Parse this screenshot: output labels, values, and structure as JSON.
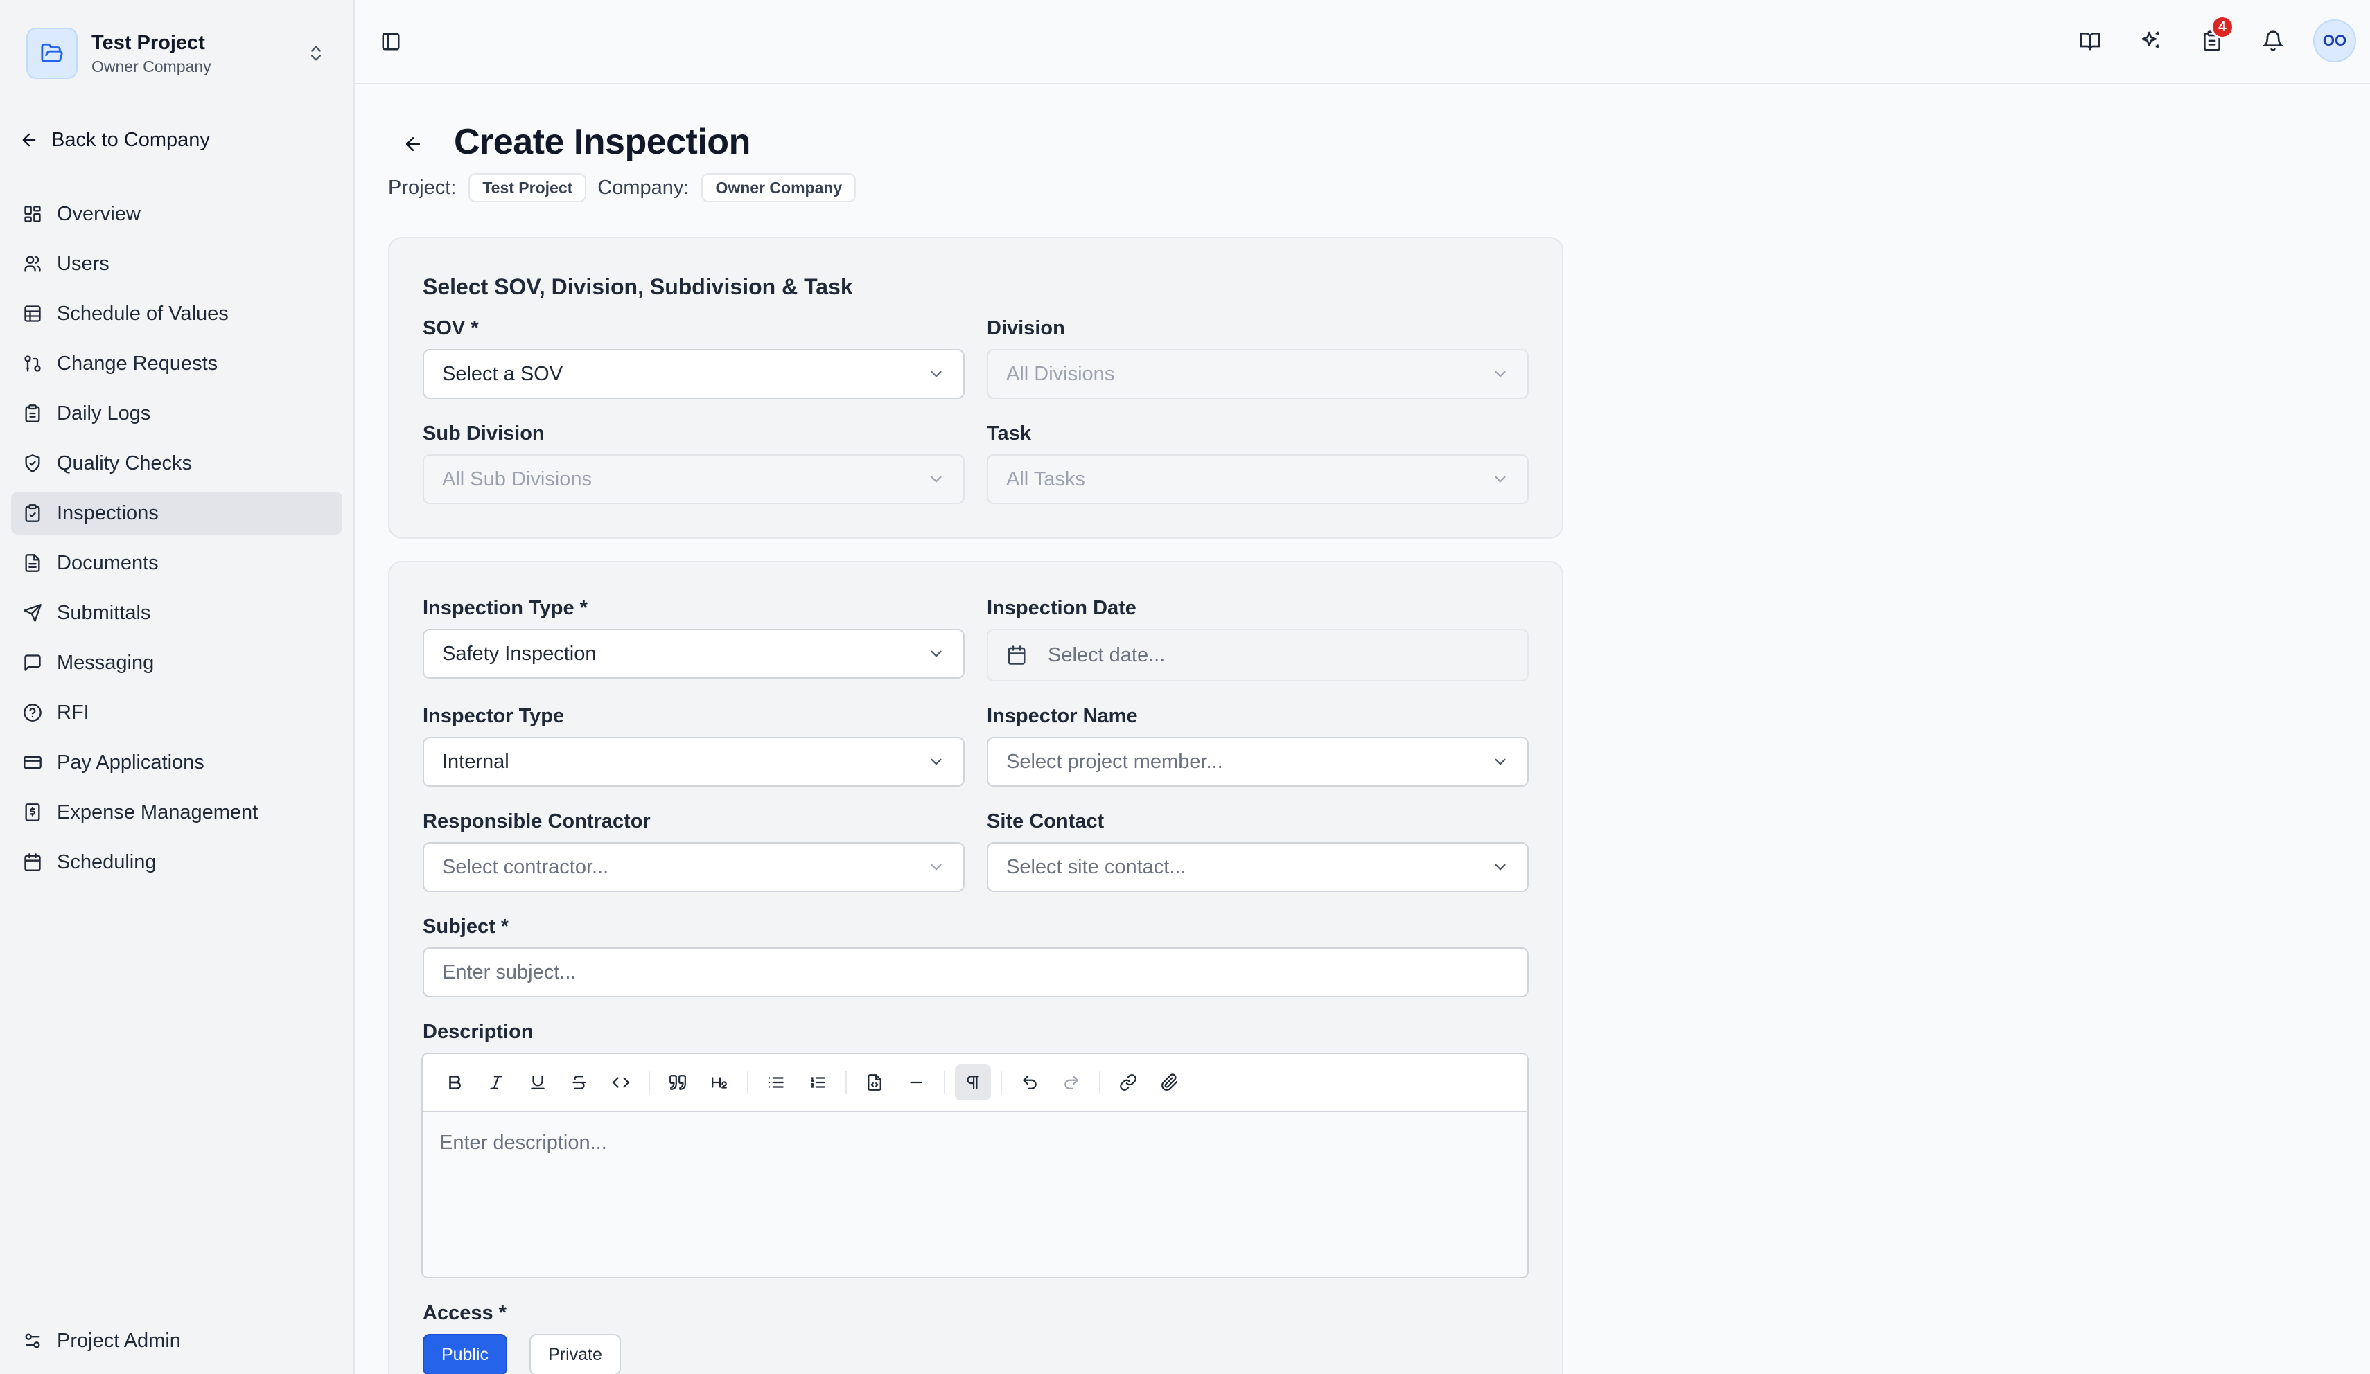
{
  "sidebar": {
    "project_name": "Test Project",
    "company_name": "Owner Company",
    "back_label": "Back to Company",
    "items": [
      {
        "label": "Overview",
        "icon": "layout-dashboard-icon"
      },
      {
        "label": "Users",
        "icon": "users-icon"
      },
      {
        "label": "Schedule of Values",
        "icon": "table-icon"
      },
      {
        "label": "Change Requests",
        "icon": "git-pull-request-icon"
      },
      {
        "label": "Daily Logs",
        "icon": "clipboard-icon"
      },
      {
        "label": "Quality Checks",
        "icon": "shield-check-icon"
      },
      {
        "label": "Inspections",
        "icon": "clipboard-check-icon",
        "active": true
      },
      {
        "label": "Documents",
        "icon": "file-text-icon"
      },
      {
        "label": "Submittals",
        "icon": "send-icon"
      },
      {
        "label": "Messaging",
        "icon": "message-square-icon"
      },
      {
        "label": "RFI",
        "icon": "help-circle-icon"
      },
      {
        "label": "Pay Applications",
        "icon": "credit-card-icon"
      },
      {
        "label": "Expense Management",
        "icon": "receipt-icon"
      },
      {
        "label": "Scheduling",
        "icon": "calendar-icon"
      }
    ],
    "admin_label": "Project Admin"
  },
  "topbar": {
    "tasks_badge": "4",
    "avatar_initials": "OO"
  },
  "page": {
    "title": "Create Inspection",
    "project_label": "Project:",
    "project_value": "Test Project",
    "company_label": "Company:",
    "company_value": "Owner Company"
  },
  "section1": {
    "title": "Select SOV, Division, Subdivision & Task",
    "sov_label": "SOV *",
    "sov_value": "Select a SOV",
    "division_label": "Division",
    "division_value": "All Divisions",
    "subdivision_label": "Sub Division",
    "subdivision_value": "All Sub Divisions",
    "task_label": "Task",
    "task_value": "All Tasks"
  },
  "section2": {
    "inspection_type_label": "Inspection Type *",
    "inspection_type_value": "Safety Inspection",
    "inspection_date_label": "Inspection Date",
    "inspection_date_placeholder": "Select date...",
    "inspector_type_label": "Inspector Type",
    "inspector_type_value": "Internal",
    "inspector_name_label": "Inspector Name",
    "inspector_name_placeholder": "Select project member...",
    "contractor_label": "Responsible Contractor",
    "contractor_placeholder": "Select contractor...",
    "site_contact_label": "Site Contact",
    "site_contact_placeholder": "Select site contact...",
    "subject_label": "Subject *",
    "subject_placeholder": "Enter subject...",
    "description_label": "Description",
    "description_placeholder": "Enter description...",
    "access_label": "Access *",
    "access_public": "Public",
    "access_private": "Private"
  },
  "colors": {
    "accent": "#2563eb",
    "badge": "#dc2626",
    "active_nav": "#e2e4e9"
  }
}
